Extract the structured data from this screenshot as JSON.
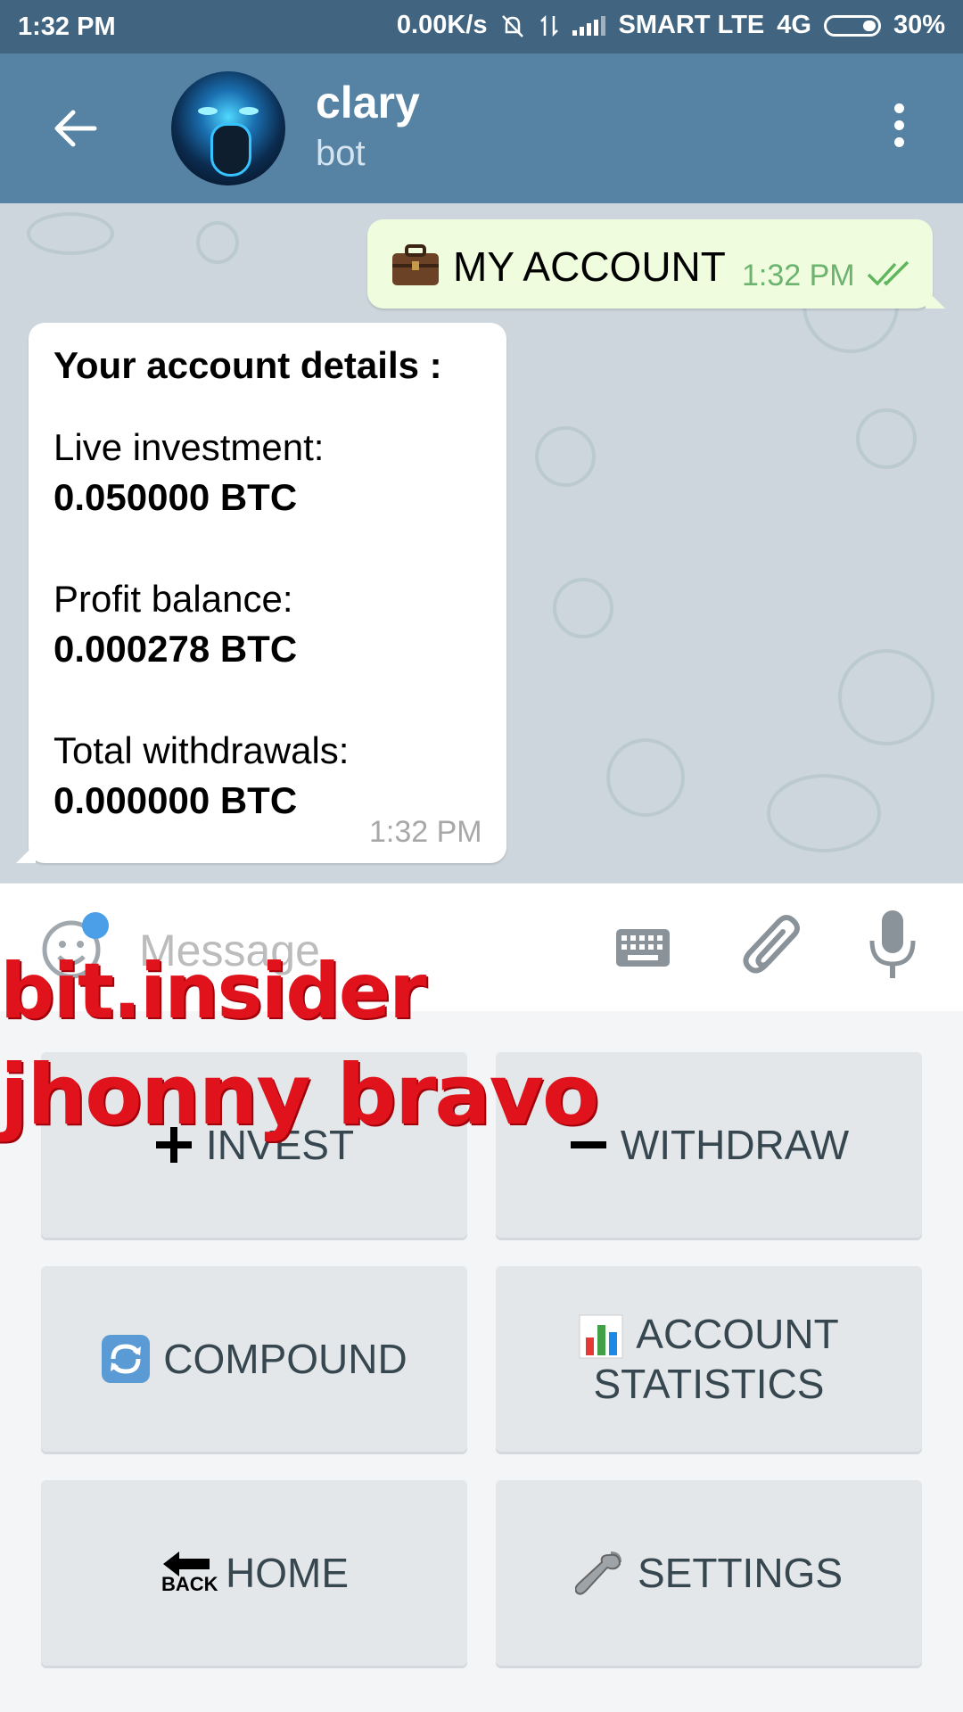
{
  "status_bar": {
    "time": "1:32 PM",
    "speed": "0.00K/s",
    "carrier": "SMART LTE",
    "network": "4G",
    "battery": "30%"
  },
  "header": {
    "title": "clary",
    "subtitle": "bot"
  },
  "messages": {
    "outgoing": {
      "text": "MY ACCOUNT",
      "time": "1:32 PM"
    },
    "incoming": {
      "heading": "Your account details :",
      "live_label": "Live investment:",
      "live_value": "0.050000 BTC",
      "profit_label": "Profit balance:",
      "profit_value": "0.000278 BTC",
      "withdrawals_label": "Total withdrawals:",
      "withdrawals_value": "0.000000 BTC",
      "time": "1:32 PM"
    }
  },
  "input": {
    "placeholder": "Message"
  },
  "keyboard": {
    "invest": "INVEST",
    "withdraw": "WITHDRAW",
    "compound": "COMPOUND",
    "account_stats_line1": "ACCOUNT",
    "account_stats_line2": "STATISTICS",
    "home": "HOME",
    "back_icon_text": "BACK",
    "settings": "SETTINGS"
  },
  "watermark": {
    "line1": "bit.insider",
    "line2": "jhonny bravo"
  },
  "colors": {
    "status_bar": "#416581",
    "header": "#5682a3",
    "outgoing_bubble": "#effdde",
    "watermark": "#e0131c"
  }
}
